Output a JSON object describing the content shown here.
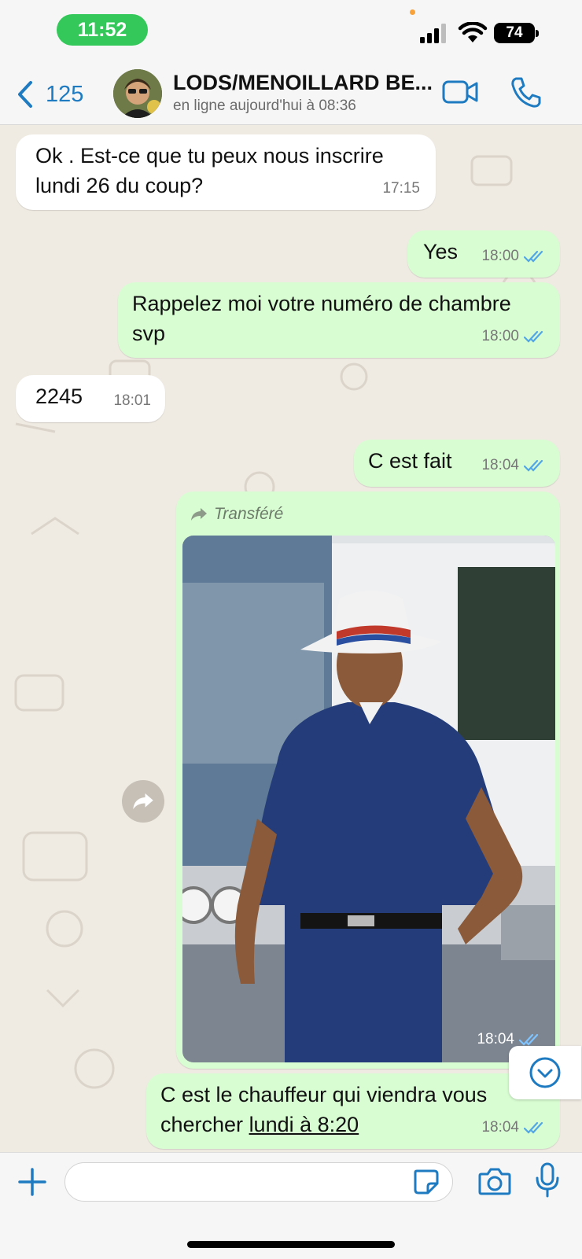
{
  "status_bar": {
    "time": "11:52",
    "battery": "74",
    "icons": [
      "signal-icon",
      "wifi-icon",
      "battery-icon"
    ]
  },
  "header": {
    "back_count": "125",
    "contact_name": "LODS/MENOILLARD BE...",
    "contact_status": "en ligne aujourd'hui à 08:36",
    "icons": [
      "chevron-left-icon",
      "video-call-icon",
      "phone-call-icon"
    ]
  },
  "messages": [
    {
      "direction": "in",
      "text": "Ok . Est-ce que tu peux nous inscrire lundi 26 du coup?",
      "time": "17:15"
    },
    {
      "direction": "out",
      "text": "Yes",
      "time": "18:00",
      "read": true
    },
    {
      "direction": "out",
      "text": "Rappelez moi votre numéro de chambre svp",
      "time": "18:00",
      "read": true
    },
    {
      "direction": "in",
      "text": "2245",
      "time": "18:01"
    },
    {
      "direction": "out",
      "text": "C est fait",
      "time": "18:04",
      "read": true
    },
    {
      "direction": "out",
      "type": "image",
      "forwarded_label": "Transféré",
      "time": "18:04",
      "read": true
    },
    {
      "direction": "out",
      "text_before": "C est le chauffeur qui viendra vous chercher ",
      "link_text": "lundi à 8:20",
      "time": "18:04",
      "read": true
    }
  ],
  "input_bar": {
    "placeholder": "",
    "icons": [
      "plus-icon",
      "sticker-icon",
      "camera-icon",
      "microphone-icon"
    ]
  },
  "colors": {
    "accent": "#1f7bc1",
    "outgoing_bubble": "#d9fdd3",
    "incoming_bubble": "#ffffff",
    "chat_background": "#efeae2",
    "read_ticks": "#53a6e6",
    "status_pill": "#34c759"
  }
}
